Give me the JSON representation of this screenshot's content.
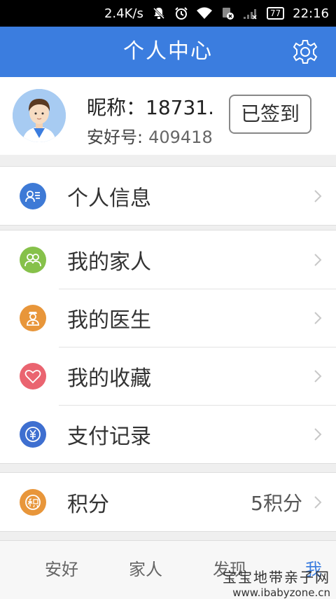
{
  "status_bar": {
    "speed": "2.4K/s",
    "battery": "77",
    "time": "22:16",
    "icons": [
      "notifications-off-icon",
      "alarm-icon",
      "wifi-icon",
      "sim-card-icon",
      "signal-icon",
      "battery-icon"
    ]
  },
  "header": {
    "title": "个人中心",
    "settings_icon": "gear-icon"
  },
  "profile": {
    "nickname_label": "昵称：",
    "nickname_value": "18731.",
    "id_label": "安好号:",
    "id_value": "409418",
    "checkin_label": "已签到"
  },
  "menu": {
    "personal_info": {
      "label": "个人信息",
      "icon": "profile-card-icon",
      "color": "#3e7ad6"
    },
    "family": {
      "label": "我的家人",
      "icon": "family-icon",
      "color": "#86c14a"
    },
    "doctor": {
      "label": "我的医生",
      "icon": "doctor-icon",
      "color": "#e8963a"
    },
    "favorites": {
      "label": "我的收藏",
      "icon": "heart-icon",
      "color": "#ea6470"
    },
    "payments": {
      "label": "支付记录",
      "icon": "yuan-icon",
      "color": "#3e6fd0"
    },
    "points": {
      "label": "积分",
      "value": "5积分",
      "icon": "points-icon",
      "color": "#e8963a"
    }
  },
  "tabs": {
    "home": "安好",
    "family": "家人",
    "discover": "发现",
    "me": "我"
  },
  "watermark": {
    "line1": "宝宝地带亲子网",
    "line2": "www.ibabyzone.cn"
  },
  "colors": {
    "accent": "#3b7ddf",
    "background": "#efefef"
  }
}
